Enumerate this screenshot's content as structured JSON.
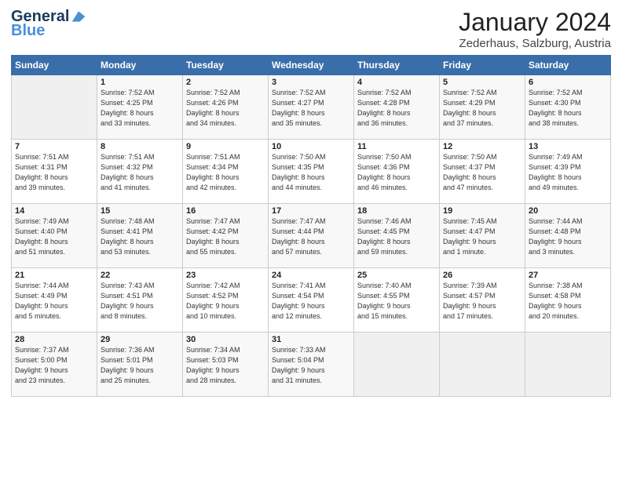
{
  "header": {
    "logo_line1": "General",
    "logo_line2": "Blue",
    "title": "January 2024",
    "subtitle": "Zederhaus, Salzburg, Austria"
  },
  "days_of_week": [
    "Sunday",
    "Monday",
    "Tuesday",
    "Wednesday",
    "Thursday",
    "Friday",
    "Saturday"
  ],
  "weeks": [
    [
      {
        "num": "",
        "info": ""
      },
      {
        "num": "1",
        "info": "Sunrise: 7:52 AM\nSunset: 4:25 PM\nDaylight: 8 hours\nand 33 minutes."
      },
      {
        "num": "2",
        "info": "Sunrise: 7:52 AM\nSunset: 4:26 PM\nDaylight: 8 hours\nand 34 minutes."
      },
      {
        "num": "3",
        "info": "Sunrise: 7:52 AM\nSunset: 4:27 PM\nDaylight: 8 hours\nand 35 minutes."
      },
      {
        "num": "4",
        "info": "Sunrise: 7:52 AM\nSunset: 4:28 PM\nDaylight: 8 hours\nand 36 minutes."
      },
      {
        "num": "5",
        "info": "Sunrise: 7:52 AM\nSunset: 4:29 PM\nDaylight: 8 hours\nand 37 minutes."
      },
      {
        "num": "6",
        "info": "Sunrise: 7:52 AM\nSunset: 4:30 PM\nDaylight: 8 hours\nand 38 minutes."
      }
    ],
    [
      {
        "num": "7",
        "info": "Sunrise: 7:51 AM\nSunset: 4:31 PM\nDaylight: 8 hours\nand 39 minutes."
      },
      {
        "num": "8",
        "info": "Sunrise: 7:51 AM\nSunset: 4:32 PM\nDaylight: 8 hours\nand 41 minutes."
      },
      {
        "num": "9",
        "info": "Sunrise: 7:51 AM\nSunset: 4:34 PM\nDaylight: 8 hours\nand 42 minutes."
      },
      {
        "num": "10",
        "info": "Sunrise: 7:50 AM\nSunset: 4:35 PM\nDaylight: 8 hours\nand 44 minutes."
      },
      {
        "num": "11",
        "info": "Sunrise: 7:50 AM\nSunset: 4:36 PM\nDaylight: 8 hours\nand 46 minutes."
      },
      {
        "num": "12",
        "info": "Sunrise: 7:50 AM\nSunset: 4:37 PM\nDaylight: 8 hours\nand 47 minutes."
      },
      {
        "num": "13",
        "info": "Sunrise: 7:49 AM\nSunset: 4:39 PM\nDaylight: 8 hours\nand 49 minutes."
      }
    ],
    [
      {
        "num": "14",
        "info": "Sunrise: 7:49 AM\nSunset: 4:40 PM\nDaylight: 8 hours\nand 51 minutes."
      },
      {
        "num": "15",
        "info": "Sunrise: 7:48 AM\nSunset: 4:41 PM\nDaylight: 8 hours\nand 53 minutes."
      },
      {
        "num": "16",
        "info": "Sunrise: 7:47 AM\nSunset: 4:42 PM\nDaylight: 8 hours\nand 55 minutes."
      },
      {
        "num": "17",
        "info": "Sunrise: 7:47 AM\nSunset: 4:44 PM\nDaylight: 8 hours\nand 57 minutes."
      },
      {
        "num": "18",
        "info": "Sunrise: 7:46 AM\nSunset: 4:45 PM\nDaylight: 8 hours\nand 59 minutes."
      },
      {
        "num": "19",
        "info": "Sunrise: 7:45 AM\nSunset: 4:47 PM\nDaylight: 9 hours\nand 1 minute."
      },
      {
        "num": "20",
        "info": "Sunrise: 7:44 AM\nSunset: 4:48 PM\nDaylight: 9 hours\nand 3 minutes."
      }
    ],
    [
      {
        "num": "21",
        "info": "Sunrise: 7:44 AM\nSunset: 4:49 PM\nDaylight: 9 hours\nand 5 minutes."
      },
      {
        "num": "22",
        "info": "Sunrise: 7:43 AM\nSunset: 4:51 PM\nDaylight: 9 hours\nand 8 minutes."
      },
      {
        "num": "23",
        "info": "Sunrise: 7:42 AM\nSunset: 4:52 PM\nDaylight: 9 hours\nand 10 minutes."
      },
      {
        "num": "24",
        "info": "Sunrise: 7:41 AM\nSunset: 4:54 PM\nDaylight: 9 hours\nand 12 minutes."
      },
      {
        "num": "25",
        "info": "Sunrise: 7:40 AM\nSunset: 4:55 PM\nDaylight: 9 hours\nand 15 minutes."
      },
      {
        "num": "26",
        "info": "Sunrise: 7:39 AM\nSunset: 4:57 PM\nDaylight: 9 hours\nand 17 minutes."
      },
      {
        "num": "27",
        "info": "Sunrise: 7:38 AM\nSunset: 4:58 PM\nDaylight: 9 hours\nand 20 minutes."
      }
    ],
    [
      {
        "num": "28",
        "info": "Sunrise: 7:37 AM\nSunset: 5:00 PM\nDaylight: 9 hours\nand 23 minutes."
      },
      {
        "num": "29",
        "info": "Sunrise: 7:36 AM\nSunset: 5:01 PM\nDaylight: 9 hours\nand 25 minutes."
      },
      {
        "num": "30",
        "info": "Sunrise: 7:34 AM\nSunset: 5:03 PM\nDaylight: 9 hours\nand 28 minutes."
      },
      {
        "num": "31",
        "info": "Sunrise: 7:33 AM\nSunset: 5:04 PM\nDaylight: 9 hours\nand 31 minutes."
      },
      {
        "num": "",
        "info": ""
      },
      {
        "num": "",
        "info": ""
      },
      {
        "num": "",
        "info": ""
      }
    ]
  ]
}
